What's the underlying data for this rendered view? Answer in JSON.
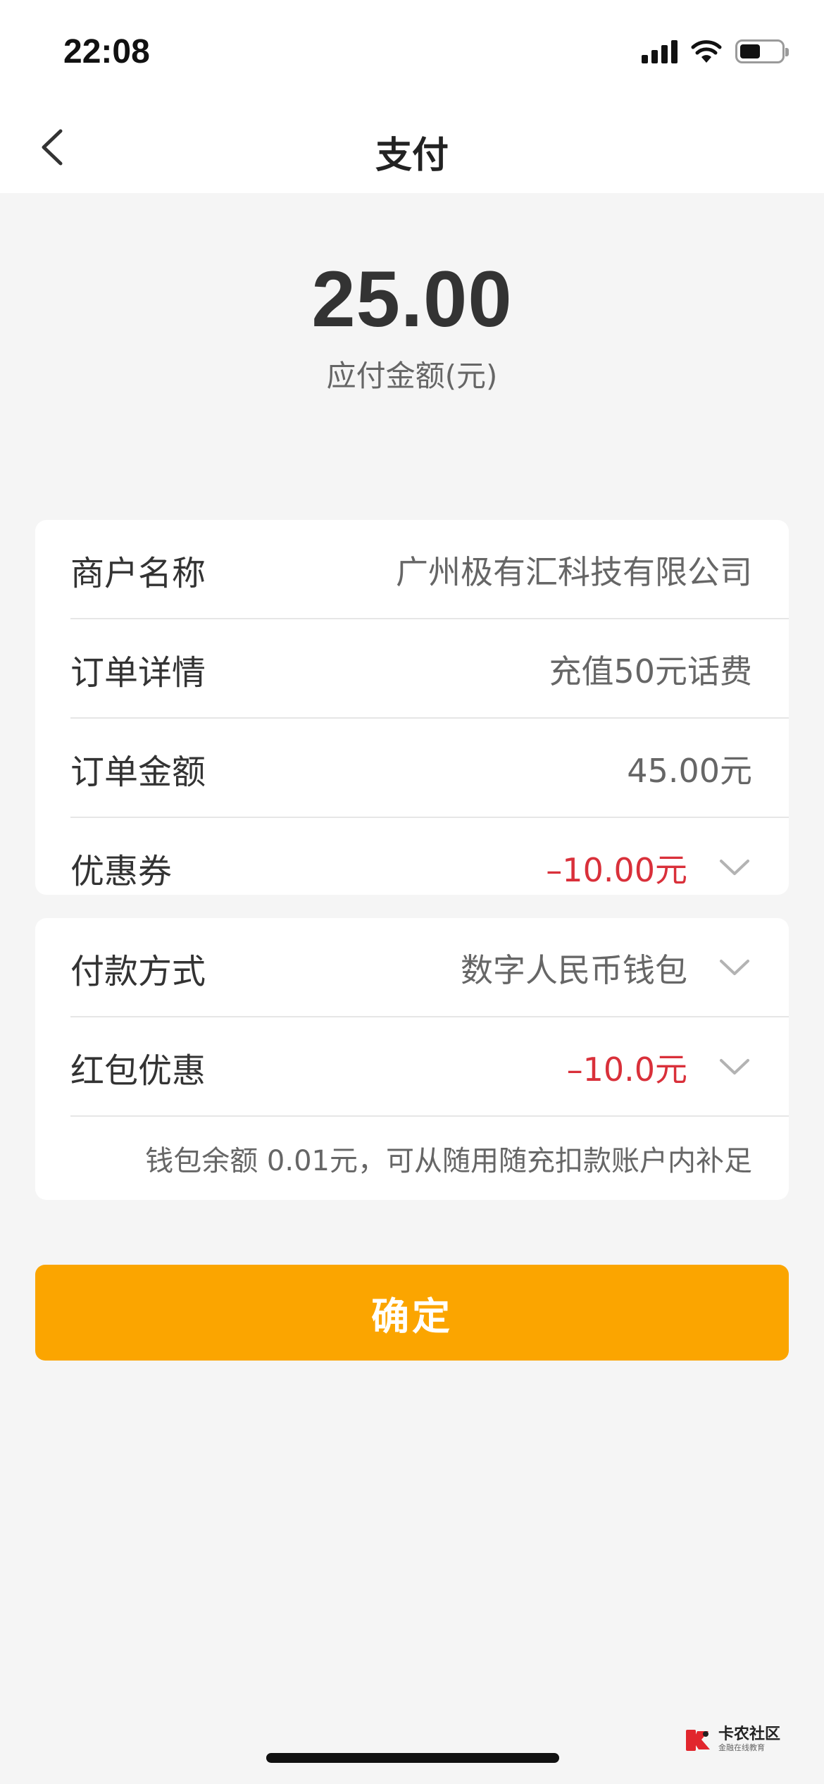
{
  "status_bar": {
    "time": "22:08",
    "icons": [
      "signal-icon",
      "wifi-icon",
      "battery-icon"
    ],
    "battery_level": 0.5
  },
  "nav": {
    "title": "支付",
    "back_icon": "chevron-left-icon"
  },
  "amount": {
    "value": "25.00",
    "label": "应付金额(元)"
  },
  "order_card": {
    "rows": [
      {
        "label": "商户名称",
        "value": "广州极有汇科技有限公司"
      },
      {
        "label": "订单详情",
        "value": "充值50元话费"
      },
      {
        "label": "订单金额",
        "value": "45.00元"
      },
      {
        "label": "优惠券",
        "value": "–10.00元",
        "icon": "chevron-down-icon"
      }
    ]
  },
  "payment_card": {
    "rows": [
      {
        "label": "付款方式",
        "value": "数字人民币钱包",
        "icon": "chevron-down-icon"
      },
      {
        "label": "红包优惠",
        "value": "–10.0元",
        "icon": "chevron-down-icon"
      }
    ],
    "balance_note": "钱包余额  0.01元，可从随用随充扣款账户内补足"
  },
  "confirm_label": "确定",
  "watermark": {
    "main": "卡农社区",
    "sub": "金融在线教育"
  },
  "colors": {
    "accent": "#fba500",
    "discount_red": "#d9303a",
    "background": "#f5f5f5"
  }
}
